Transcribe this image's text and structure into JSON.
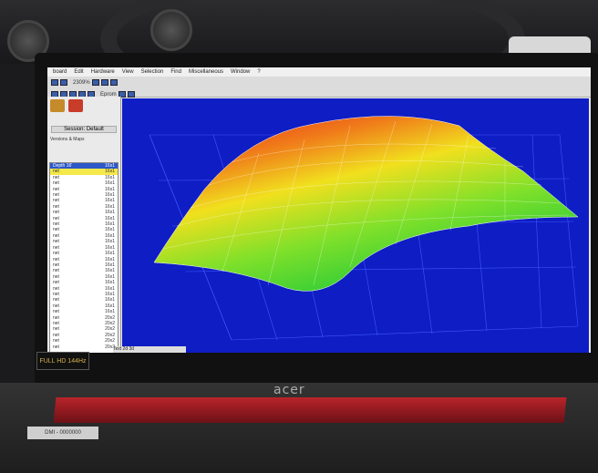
{
  "menu": [
    "board",
    "Edit",
    "Hardware",
    "View",
    "Selection",
    "Find",
    "Miscellaneous",
    "Window",
    "?"
  ],
  "toolbar": {
    "eprom_label": "Eprom",
    "zoom": "2309%"
  },
  "sidebar": {
    "session_label": "Session: Default",
    "versions_label": "Versions & Maps",
    "list_header": {
      "name": "Depth 16'",
      "size": "16x1"
    },
    "rows": [
      "16x1",
      "16x1",
      "16x1",
      "16x1",
      "16x1",
      "16x1",
      "16x1",
      "16x1",
      "16x1",
      "16x1",
      "16x1",
      "16x1",
      "16x1",
      "16x1",
      "16x1",
      "16x1",
      "16x1",
      "16x1",
      "16x1",
      "16x1",
      "16x1",
      "16x1",
      "16x1",
      "16x1",
      "16x1",
      "20x2",
      "20x2",
      "20x2",
      "20x2",
      "20x2",
      "20x2"
    ]
  },
  "statusbar": "Text 2d 3d",
  "laptop": {
    "brand": "acer",
    "badge": "FULL HD 144Hz",
    "sticker": "DMI - 0000000"
  },
  "colors": {
    "plot_bg": "#0f1dc4",
    "accent": "#2c58c8",
    "surface_high": "#e3201a",
    "surface_low": "#37d23a"
  }
}
